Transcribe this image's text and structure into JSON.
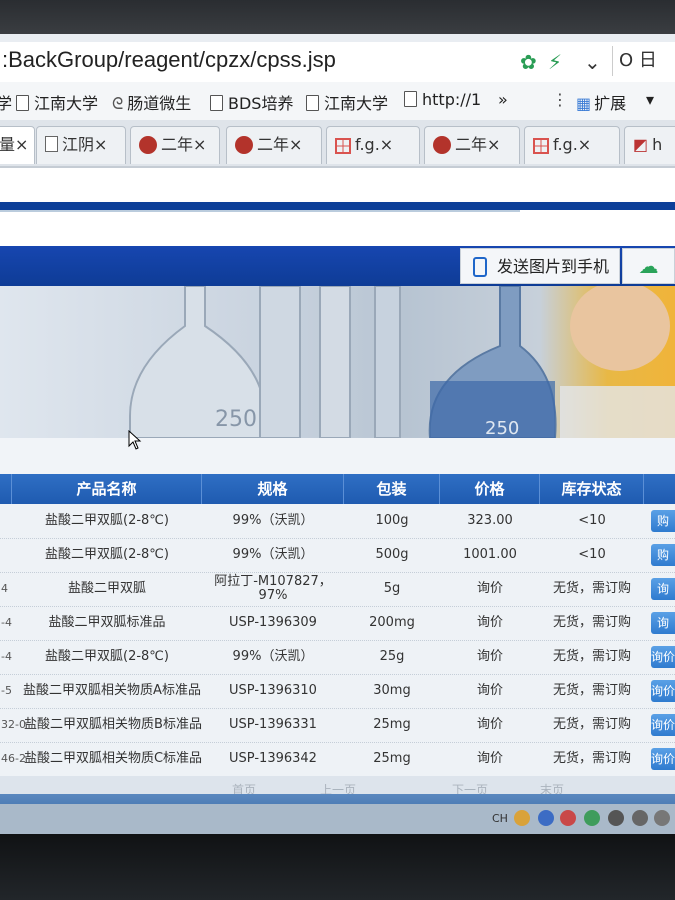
{
  "browser": {
    "url": ":BackGroup/reagent/cpzx/cpss.jsp",
    "search_label": "O 日",
    "bookmarks": [
      "学",
      "江南大学",
      "肠道微生",
      "BDS培养",
      "江南大学",
      "http://1",
      "»",
      "扩展"
    ],
    "tabs": [
      {
        "label": "量×",
        "active": true
      },
      {
        "label": "江阴×"
      },
      {
        "label": "二年×"
      },
      {
        "label": "二年×"
      },
      {
        "label": "f.g.×"
      },
      {
        "label": "二年×"
      },
      {
        "label": "f.g.×"
      },
      {
        "label": "h"
      }
    ]
  },
  "page": {
    "send_button": "发送图片到手机",
    "banner_marks": [
      "250",
      "250"
    ]
  },
  "table": {
    "headers": [
      "产品名称",
      "规格",
      "包装",
      "价格",
      "库存状态"
    ],
    "rows": [
      {
        "cas": "",
        "name": "盐酸二甲双胍(2-8℃)",
        "spec": "99%（沃凯）",
        "pack": "100g",
        "price": "323.00",
        "stock": "<10",
        "action": "购"
      },
      {
        "cas": "",
        "name": "盐酸二甲双胍(2-8℃)",
        "spec": "99%（沃凯）",
        "pack": "500g",
        "price": "1001.00",
        "stock": "<10",
        "action": "购"
      },
      {
        "cas": "4",
        "name": "盐酸二甲双胍",
        "spec": "阿拉丁-M107827，97%",
        "pack": "5g",
        "price": "询价",
        "stock": "无货，需订购",
        "action": "询"
      },
      {
        "cas": "-4",
        "name": "盐酸二甲双胍标准品",
        "spec": "USP-1396309",
        "pack": "200mg",
        "price": "询价",
        "stock": "无货，需订购",
        "action": "询"
      },
      {
        "cas": "-4",
        "name": "盐酸二甲双胍(2-8℃)",
        "spec": "99%（沃凯）",
        "pack": "25g",
        "price": "询价",
        "stock": "无货，需订购",
        "action": "询价"
      },
      {
        "cas": "-5",
        "name": "盐酸二甲双胍相关物质A标准品",
        "spec": "USP-1396310",
        "pack": "30mg",
        "price": "询价",
        "stock": "无货，需订购",
        "action": "询价"
      },
      {
        "cas": "32-0",
        "name": "盐酸二甲双胍相关物质B标准品",
        "spec": "USP-1396331",
        "pack": "25mg",
        "price": "询价",
        "stock": "无货，需订购",
        "action": "询价"
      },
      {
        "cas": "46-2",
        "name": "盐酸二甲双胍相关物质C标准品",
        "spec": "USP-1396342",
        "pack": "25mg",
        "price": "询价",
        "stock": "无货，需订购",
        "action": "询价"
      }
    ]
  },
  "pager": [
    "首页",
    "上一页",
    "下一页",
    "末页"
  ],
  "tray_lang": "CH"
}
